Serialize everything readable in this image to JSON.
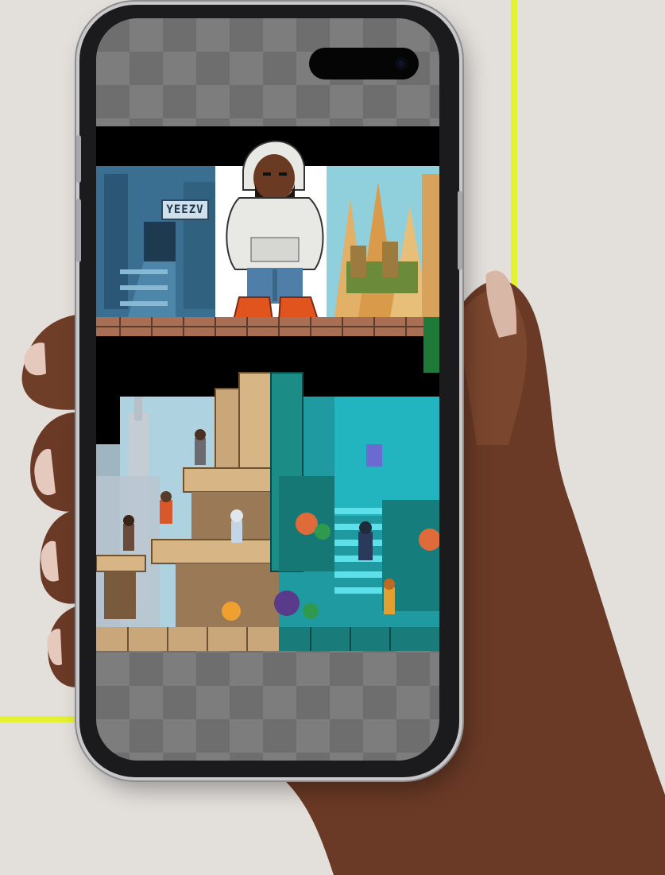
{
  "scene": {
    "sign_text": "YEEZV"
  },
  "colors": {
    "background": "#e3e0dc",
    "accent": "#e4f232",
    "phone_frame": "#1b1b1d",
    "checker_dark": "#6e6e6e",
    "checker_light": "#7d7d7d",
    "hoodie": "#e8e8e4",
    "jeans": "#4f7fa8",
    "boots": "#e2541e",
    "city_left": "#3b6f92",
    "city_right": "#e2b066",
    "teal_world": "#1f9aa0",
    "stone": "#c9a77a"
  }
}
